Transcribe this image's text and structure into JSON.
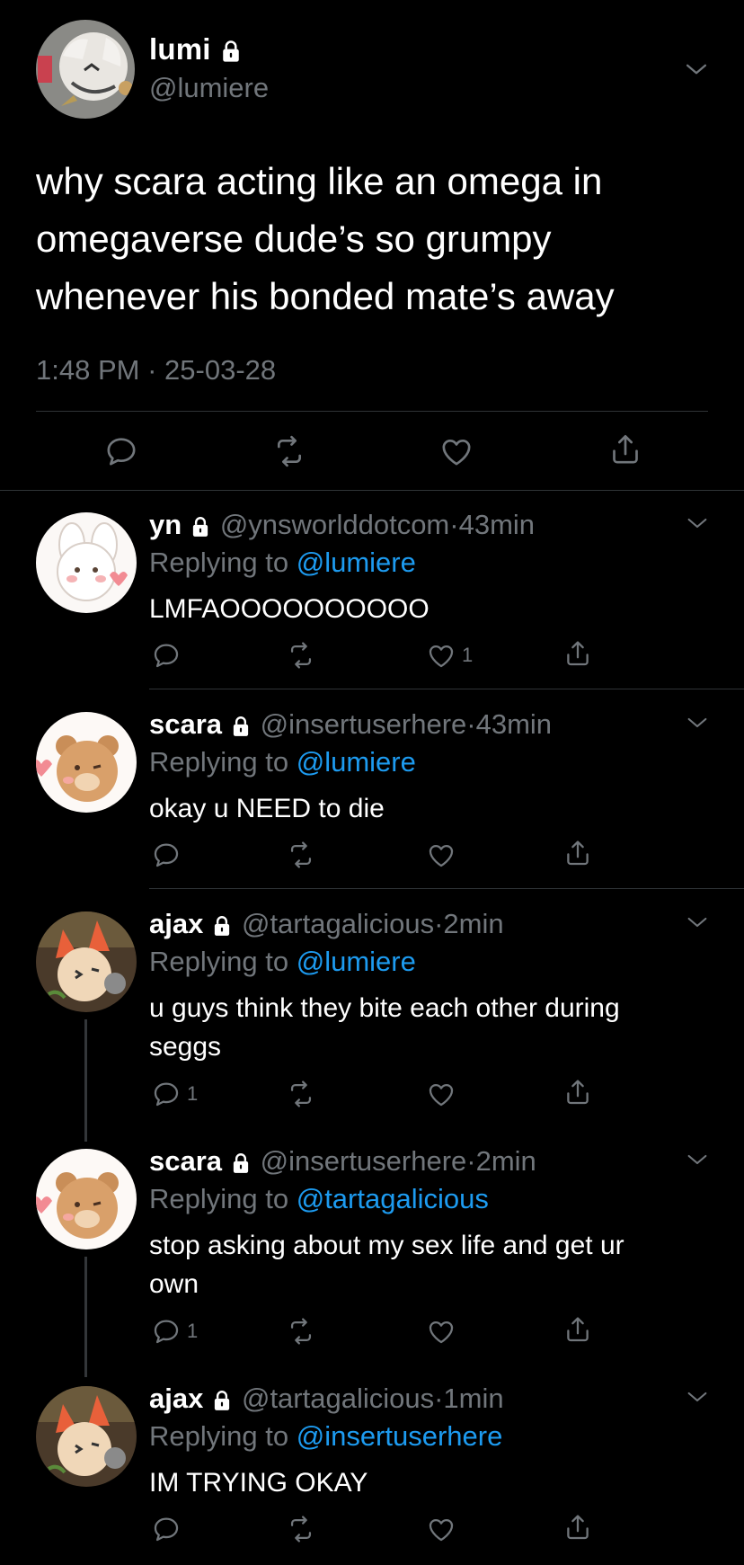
{
  "main_tweet": {
    "name": "lumi",
    "handle": "@lumiere",
    "text_lines": [
      "why scara acting like an omega in",
      "omegaverse dude’s so grumpy",
      "whenever his bonded mate’s away"
    ],
    "time": "1:48 PM",
    "separator": "·",
    "date": "25-03-28"
  },
  "replies": [
    {
      "name": "yn",
      "handle": "@ynsworlddotcom",
      "time": "43min",
      "replying_prefix": "Replying to",
      "replying_to": "@lumiere",
      "text": "LMFAOOOOOOOOOO",
      "reply_count": "",
      "like_count": "1"
    },
    {
      "name": "scara",
      "handle": "@insertuserhere",
      "time": "43min",
      "replying_prefix": "Replying to",
      "replying_to": "@lumiere",
      "text": "okay u NEED to die",
      "reply_count": "",
      "like_count": ""
    },
    {
      "name": "ajax",
      "handle": "@tartagalicious",
      "time": "2min",
      "replying_prefix": "Replying to",
      "replying_to": "@lumiere",
      "text_lines": [
        "u guys think they bite each other during",
        "seggs"
      ],
      "reply_count": "1",
      "like_count": ""
    },
    {
      "name": "scara",
      "handle": "@insertuserhere",
      "time": "2min",
      "replying_prefix": "Replying to",
      "replying_to": "@tartagalicious",
      "text_lines": [
        "stop asking about my sex life and get ur",
        "own"
      ],
      "reply_count": "1",
      "like_count": ""
    },
    {
      "name": "ajax",
      "handle": "@tartagalicious",
      "time": "1min",
      "replying_prefix": "Replying to",
      "replying_to": "@insertuserhere",
      "text": "IM TRYING OKAY",
      "reply_count": "",
      "like_count": ""
    }
  ],
  "icons": {
    "lock": "lock-icon",
    "more": "chevron-down-icon",
    "reply": "reply-icon",
    "retweet": "retweet-icon",
    "like": "heart-icon",
    "share": "share-icon"
  },
  "colors": {
    "background": "#000000",
    "text": "#ffffff",
    "secondary": "#71767b",
    "link": "#1d9bf0",
    "divider": "#2f3336"
  }
}
